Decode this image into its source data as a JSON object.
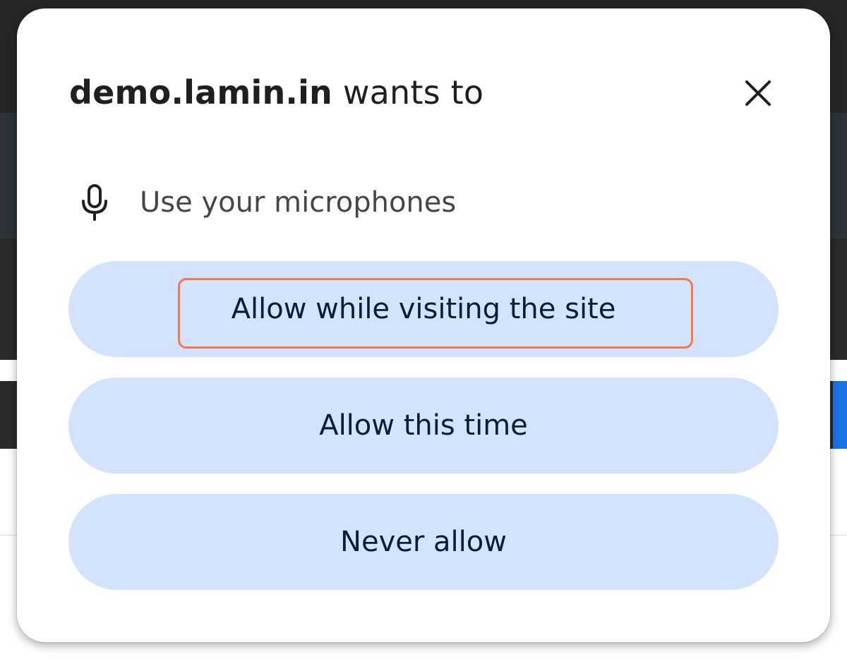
{
  "dialog": {
    "title_origin": "demo.lamin.in",
    "title_rest": "wants to",
    "close_icon": "close-icon",
    "permission": {
      "icon": "microphone-icon",
      "label": "Use your microphones"
    },
    "buttons": {
      "allow_while_visiting": "Allow while visiting the site",
      "allow_this_time": "Allow this time",
      "never_allow": "Never allow"
    },
    "colors": {
      "pill_background": "#d3e3fd",
      "highlight_border": "#f4784a"
    }
  }
}
